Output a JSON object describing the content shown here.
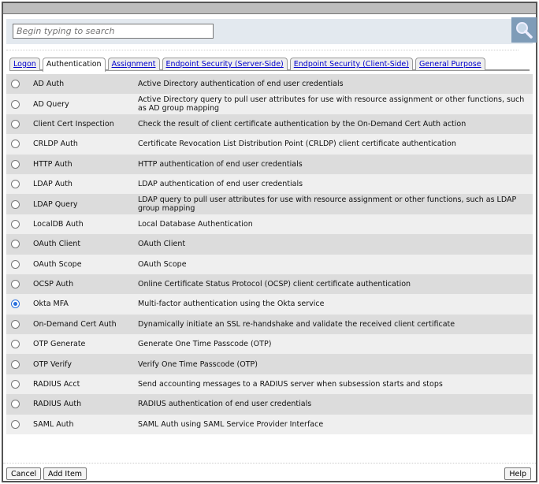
{
  "search": {
    "placeholder": "Begin typing to search"
  },
  "tabs": [
    {
      "label": "Logon",
      "active": false
    },
    {
      "label": "Authentication",
      "active": true
    },
    {
      "label": "Assignment",
      "active": false
    },
    {
      "label": "Endpoint Security (Server-Side)",
      "active": false
    },
    {
      "label": "Endpoint Security (Client-Side)",
      "active": false
    },
    {
      "label": "General Purpose",
      "active": false
    }
  ],
  "items": [
    {
      "name": "AD Auth",
      "desc": "Active Directory authentication of end user credentials",
      "selected": false
    },
    {
      "name": "AD Query",
      "desc": "Active Directory query to pull user attributes for use with resource assignment or other functions, such as AD group mapping",
      "selected": false
    },
    {
      "name": "Client Cert Inspection",
      "desc": "Check the result of client certificate authentication by the On-Demand Cert Auth action",
      "selected": false
    },
    {
      "name": "CRLDP Auth",
      "desc": "Certificate Revocation List Distribution Point (CRLDP) client certificate authentication",
      "selected": false
    },
    {
      "name": "HTTP Auth",
      "desc": "HTTP authentication of end user credentials",
      "selected": false
    },
    {
      "name": "LDAP Auth",
      "desc": "LDAP authentication of end user credentials",
      "selected": false
    },
    {
      "name": "LDAP Query",
      "desc": "LDAP query to pull user attributes for use with resource assignment or other functions, such as LDAP group mapping",
      "selected": false
    },
    {
      "name": "LocalDB Auth",
      "desc": "Local Database Authentication",
      "selected": false
    },
    {
      "name": "OAuth Client",
      "desc": "OAuth Client",
      "selected": false
    },
    {
      "name": "OAuth Scope",
      "desc": "OAuth Scope",
      "selected": false
    },
    {
      "name": "OCSP Auth",
      "desc": "Online Certificate Status Protocol (OCSP) client certificate authentication",
      "selected": false
    },
    {
      "name": "Okta MFA",
      "desc": "Multi-factor authentication using the Okta service",
      "selected": true
    },
    {
      "name": "On-Demand Cert Auth",
      "desc": "Dynamically initiate an SSL re-handshake and validate the received client certificate",
      "selected": false
    },
    {
      "name": "OTP Generate",
      "desc": "Generate One Time Passcode (OTP)",
      "selected": false
    },
    {
      "name": "OTP Verify",
      "desc": "Verify One Time Passcode (OTP)",
      "selected": false
    },
    {
      "name": "RADIUS Acct",
      "desc": "Send accounting messages to a RADIUS server when subsession starts and stops",
      "selected": false
    },
    {
      "name": "RADIUS Auth",
      "desc": "RADIUS authentication of end user credentials",
      "selected": false
    },
    {
      "name": "SAML Auth",
      "desc": "SAML Auth using SAML Service Provider Interface",
      "selected": false
    }
  ],
  "buttons": {
    "cancel": "Cancel",
    "add": "Add Item",
    "help": "Help"
  },
  "icons": {
    "search": "magnifier-icon"
  }
}
